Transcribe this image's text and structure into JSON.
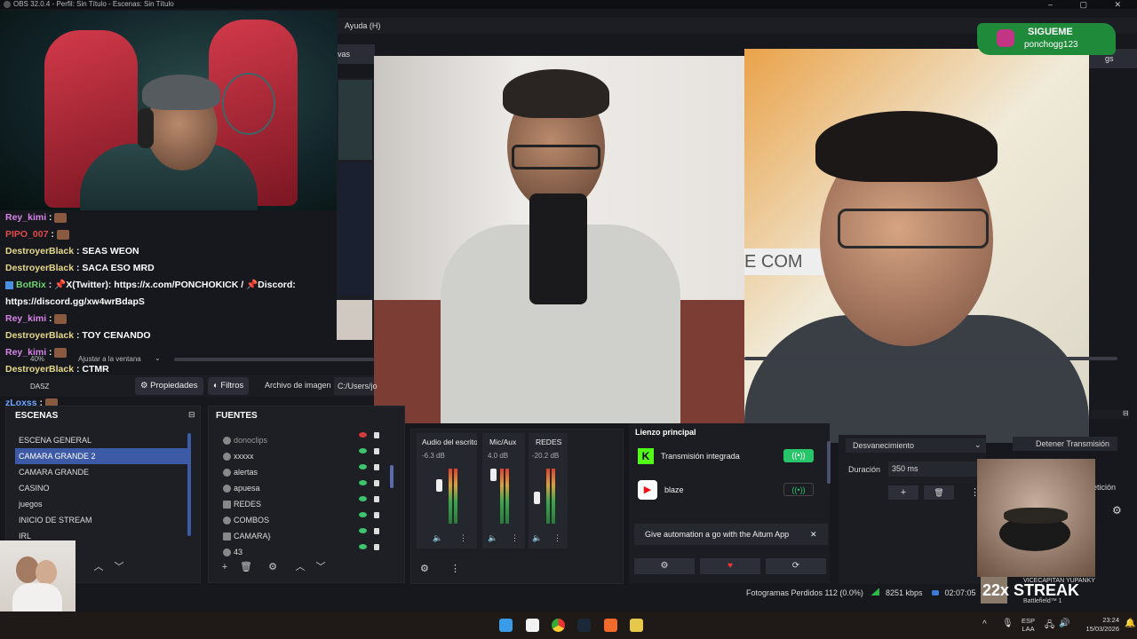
{
  "window": {
    "title": "OBS 32.0.4 - Perfil: Sin Título - Escenas: Sin Título",
    "controls": "– ▢ ✕"
  },
  "menu": {
    "help": "Ayuda (H)",
    "tab_fragment": "vas"
  },
  "overlay": {
    "follow_title": "SIGUEME",
    "follow_handle": "ponchogg123",
    "streak": "22x STREAK",
    "streak_user": "VICECAPITAN YUPANKY",
    "streak_game": "Battlefield™ 1",
    "ig_color": "#c13584",
    "banner_color": "#1f8a3a"
  },
  "chat": [
    {
      "user": "Rey_kimi",
      "text": "",
      "user_color": "pink",
      "emote": true
    },
    {
      "user": "PIPO_007",
      "text": "",
      "user_color": "red",
      "emote": true,
      "badge": true
    },
    {
      "user": "DestroyerBlack",
      "text": "SEAS WEON",
      "user_color": "gold",
      "emote": false,
      "badge": true
    },
    {
      "user": "DestroyerBlack",
      "text": "SACA ESO MRD",
      "user_color": "gold",
      "emote": false,
      "badge": true
    },
    {
      "user": "BotRix",
      "text": "📌X(Twitter): https://x.com/PONCHOKICK / 📌Discord:",
      "user_color": "blue",
      "emote": false,
      "badge": true
    },
    {
      "user": "",
      "text": "https://discord.gg/xw4wrBdapS",
      "user_color": "gold",
      "emote": false
    },
    {
      "user": "Rey_kimi",
      "text": "",
      "user_color": "pink",
      "emote": true
    },
    {
      "user": "DestroyerBlack",
      "text": "TOY CENANDO",
      "user_color": "gold",
      "emote": false,
      "badge": true
    },
    {
      "user": "Rey_kimi",
      "text": "",
      "user_color": "pink",
      "emote": true
    },
    {
      "user": "DestroyerBlack",
      "text": "CTMR",
      "user_color": "gold",
      "emote": false,
      "badge": true
    },
    {
      "user": "zLoxss",
      "text": "",
      "user_color": "blue",
      "emote": true
    },
    {
      "user": "zLoxss",
      "text": "",
      "user_color": "blue",
      "emote": true
    }
  ],
  "preview_bar": {
    "zoom": "40%",
    "fit": "Ajustar a la ventana",
    "dasz": "DASZ"
  },
  "props_bar": {
    "properties": "Propiedades",
    "filters": "Filtros",
    "image_file": "Archivo de imagen",
    "path": "C:/Users/jo"
  },
  "scenes": {
    "title": "ESCENAS",
    "items": [
      "ESCENA GENERAL",
      "CAMARA GRANDE 2",
      "CAMARA GRANDE",
      "CASINO",
      "juegos",
      "INICIO DE STREAM",
      "IRL"
    ],
    "selected": 1
  },
  "sources": {
    "title": "FUENTES",
    "items": [
      {
        "name": "donoclips",
        "visible": false
      },
      {
        "name": "xxxxx",
        "visible": true
      },
      {
        "name": "alertas",
        "visible": true
      },
      {
        "name": "apuesa",
        "visible": true
      },
      {
        "name": "REDES",
        "visible": true
      },
      {
        "name": "COMBOS",
        "visible": true
      },
      {
        "name": "CAMARA}",
        "visible": true
      },
      {
        "name": "43",
        "visible": true
      }
    ]
  },
  "mixer": {
    "channels": [
      {
        "name": "Audio del escrito",
        "db": "-6.3 dB",
        "level": 0.7
      },
      {
        "name": "Mic/Aux",
        "db": "4.0 dB",
        "level": 0.8
      },
      {
        "name": "REDES",
        "db": "-20.2 dB",
        "level": 0.4
      }
    ]
  },
  "stream": {
    "title": "Lienzo principal",
    "services": [
      {
        "name": "Transmisión integrada",
        "active": true
      },
      {
        "name": "blaze",
        "active": false
      }
    ],
    "promo": "Give automation a go with the Aitum App",
    "close": "✕"
  },
  "transitions": {
    "fade": "Desvanecimiento",
    "stop": "Detener Transmisión",
    "duration_label": "Duración",
    "duration_value": "350 ms",
    "plus": "+",
    "extra": "etición"
  },
  "status": {
    "dropped": "Fotogramas Perdidos 112 (0.0%)",
    "bitrate": "8251 kbps",
    "time": "02:07:05"
  },
  "taskbar": {
    "lang1": "ESP",
    "lang2": "LAA",
    "time": "23:24",
    "date": "15/03/2026"
  }
}
